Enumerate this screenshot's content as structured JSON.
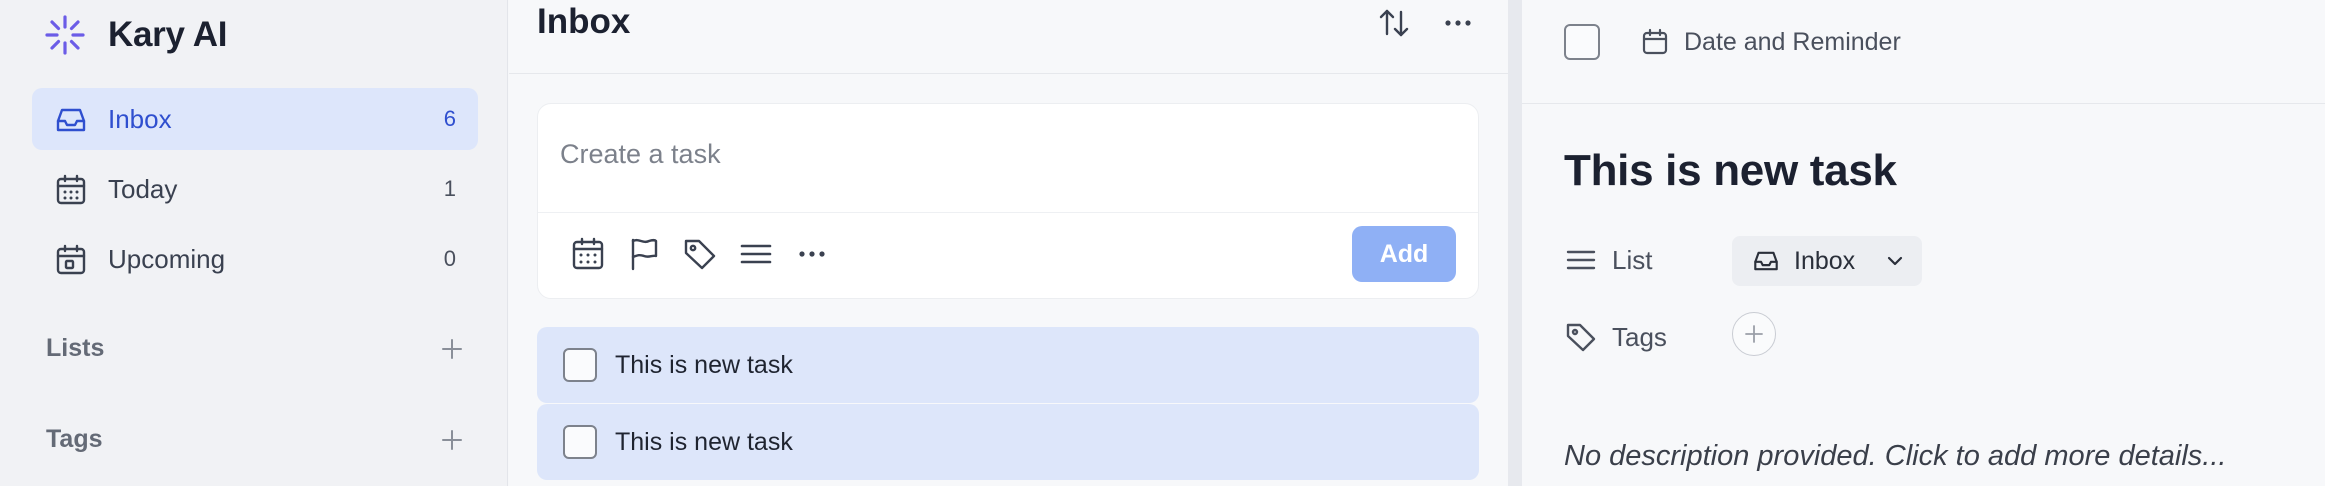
{
  "app": {
    "name": "Kary AI",
    "brand_color": "#6b5ce7"
  },
  "sidebar": {
    "items": [
      {
        "label": "Inbox",
        "count": "6",
        "icon": "inbox-icon",
        "active": true
      },
      {
        "label": "Today",
        "count": "1",
        "icon": "calendar-grid-icon",
        "active": false
      },
      {
        "label": "Upcoming",
        "count": "0",
        "icon": "calendar-upcoming-icon",
        "active": false
      }
    ],
    "sections": [
      {
        "label": "Lists",
        "icon": "plus-icon"
      },
      {
        "label": "Tags",
        "icon": "plus-icon"
      }
    ]
  },
  "main": {
    "title": "Inbox",
    "composer": {
      "placeholder": "Create a task",
      "add_label": "Add",
      "tools": [
        "calendar-icon",
        "flag-icon",
        "tag-icon",
        "list-icon",
        "more-icon"
      ]
    },
    "tasks": [
      {
        "title": "This is new task",
        "checked": false
      },
      {
        "title": "This is new task",
        "checked": false
      }
    ]
  },
  "detail": {
    "date_label": "Date and Reminder",
    "title": "This is new task",
    "list_label": "List",
    "list_value": "Inbox",
    "tags_label": "Tags",
    "description_placeholder": "No description provided. Click to add more details..."
  },
  "colors": {
    "active_bg": "#dde6fb",
    "accent": "#2f4fcf",
    "add_button": "#8fb0f5",
    "task_row": "#dde6fa"
  }
}
